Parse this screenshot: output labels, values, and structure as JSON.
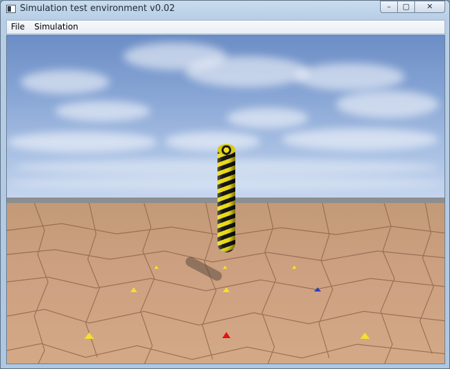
{
  "window": {
    "title": "Simulation test environment v0.02",
    "controls": {
      "minimize": "–",
      "maximize": "▢",
      "close": "✕"
    }
  },
  "menu": {
    "items": [
      {
        "label": "File"
      },
      {
        "label": "Simulation"
      }
    ]
  },
  "scene": {
    "sky_color": "#86a4d4",
    "ground_color": "#cca080",
    "horizon_color": "#8d8e90",
    "pillar_colors": [
      "#e8d81a",
      "#161616"
    ],
    "marker_colors": {
      "yellow": "#f3e12a",
      "blue": "#2340c8",
      "red": "#e01414"
    }
  }
}
